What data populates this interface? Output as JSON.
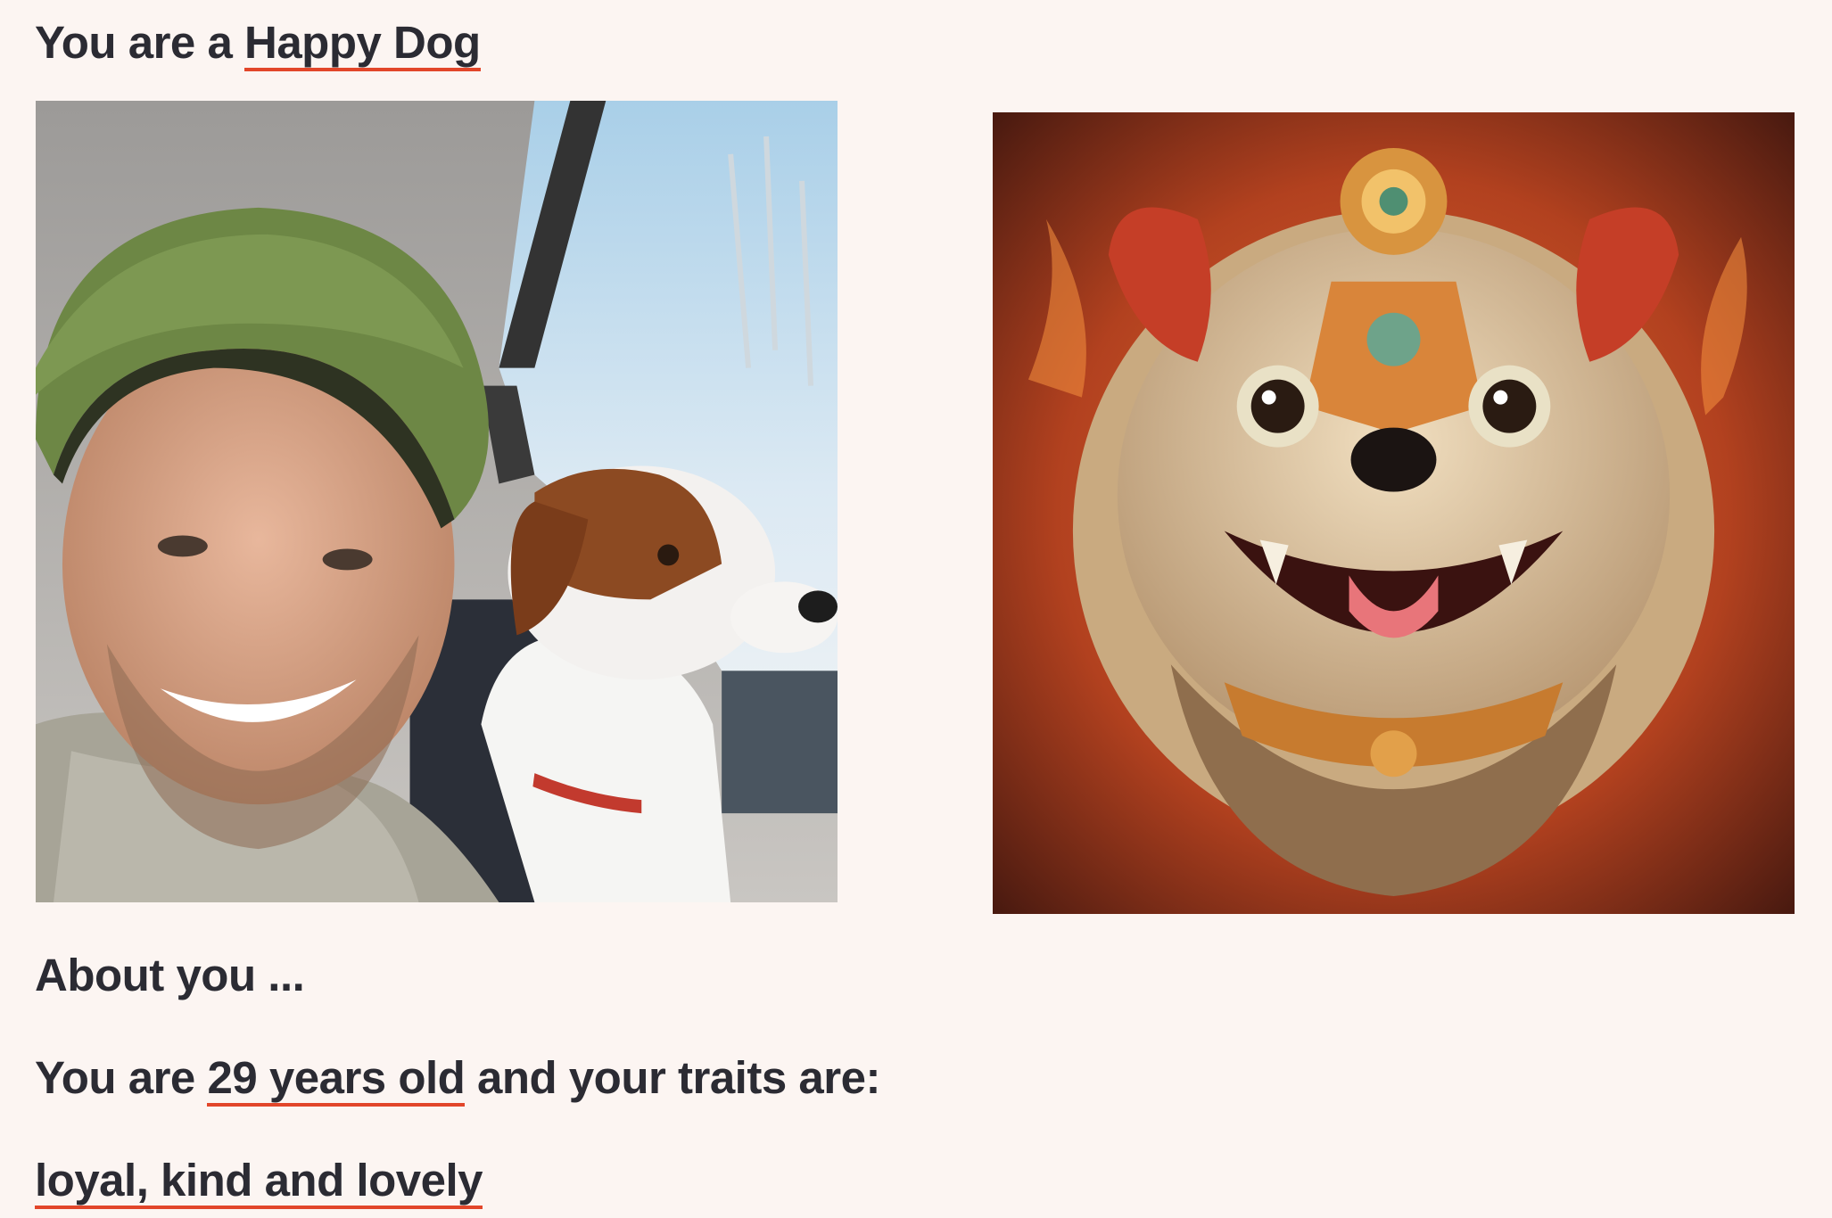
{
  "heading": {
    "prefix": "You are a ",
    "animal_type": "Happy Dog"
  },
  "photos": {
    "original": "selfie-man-with-dog-photo",
    "generated": "ornate-lion-dog-illustration"
  },
  "about": {
    "title": "About you ...",
    "age_prefix": "You are ",
    "age": "29 years old",
    "age_suffix": " and your traits are:",
    "traits": "loyal, kind and lovely"
  },
  "colors": {
    "background": "#fcf5f2",
    "text": "#2b2b33",
    "underline": "#e2462a"
  }
}
